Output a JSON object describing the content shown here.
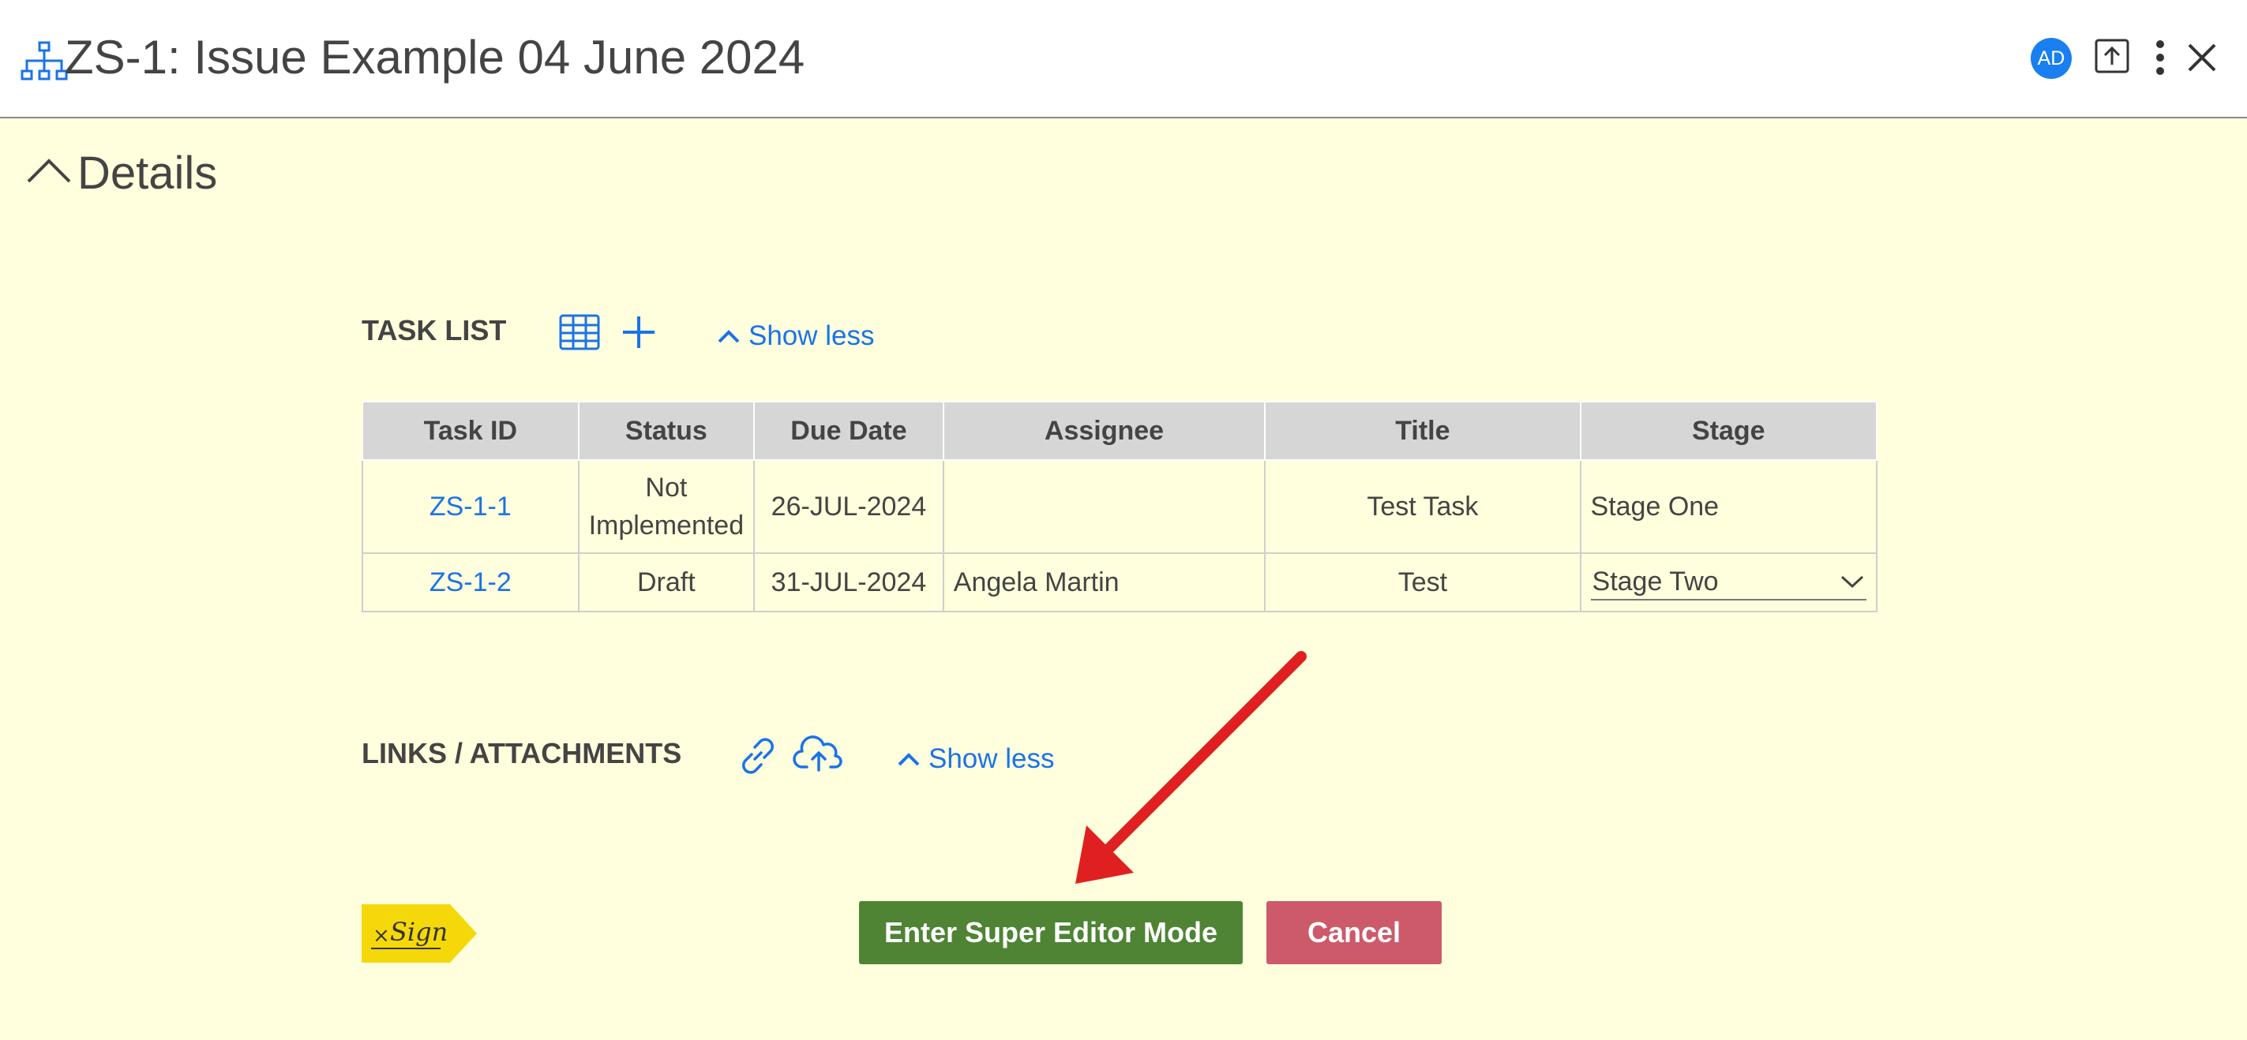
{
  "header": {
    "title": "ZS-1: Issue Example 04 June 2024",
    "avatar_initials": "AD",
    "icons": {
      "left": "hierarchy-icon",
      "upload": "upload-icon",
      "more": "more-vertical-icon",
      "close": "close-icon"
    }
  },
  "details": {
    "title": "Details",
    "toggle_icon": "chevron-up-icon"
  },
  "task_list": {
    "label": "TASK LIST",
    "show_less": "Show less",
    "icons": [
      "table-icon",
      "plus-icon"
    ],
    "columns": [
      "Task ID",
      "Status",
      "Due Date",
      "Assignee",
      "Title",
      "Stage"
    ],
    "rows": [
      {
        "task_id": "ZS-1-1",
        "status": "Not Implemented",
        "due_date": "26-JUL-2024",
        "assignee": "",
        "title": "Test Task",
        "stage": "Stage One"
      },
      {
        "task_id": "ZS-1-2",
        "status": "Draft",
        "due_date": "31-JUL-2024",
        "assignee": "Angela Martin",
        "title": "Test",
        "stage": "Stage Two"
      }
    ]
  },
  "links": {
    "label": "LINKS / ATTACHMENTS",
    "show_less": "Show less",
    "icons": [
      "link-icon",
      "cloud-upload-icon"
    ]
  },
  "xsign": {
    "label": "Sign",
    "icon": "xsign-tag-icon"
  },
  "actions": {
    "primary": "Enter Super Editor Mode",
    "cancel": "Cancel"
  },
  "colors": {
    "background": "#ffffdd",
    "accent": "#1a73e8",
    "primary_button": "#4e8434",
    "cancel_button": "#cc5a6a",
    "arrow": "#e02020",
    "xsign": "#f5d80a"
  }
}
